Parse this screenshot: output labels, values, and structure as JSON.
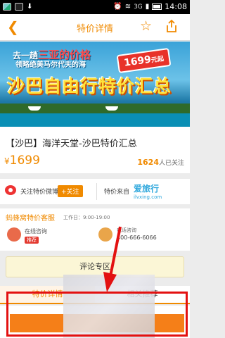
{
  "statusbar": {
    "network": "3G",
    "time": "14:08"
  },
  "header": {
    "back_glyph": "❮",
    "title": "特价详情"
  },
  "banner": {
    "line1_a": "去一趟",
    "line1_hl": "三亚的价格",
    "line2": "领略绝美马尔代夫的海",
    "price": "1699",
    "price_unit": "元起",
    "headline": "沙巴自由行特价汇总"
  },
  "product": {
    "title": "【沙巴】海洋天堂-沙巴特价汇总",
    "currency": "¥",
    "price": "1699",
    "follow_count": "1624",
    "follow_suffix": "人已关注"
  },
  "weibo": {
    "label": "关注特价微博",
    "button": "+关注"
  },
  "source": {
    "label": "特价来自",
    "logo_main": "爱旅行",
    "logo_sub": "ilvxing.com"
  },
  "service": {
    "title": "蚂蜂窝特价客服",
    "hours": "工作日：9:00-19:00",
    "online_label": "在线咨询",
    "recommend": "推荐",
    "phone_label": "电话咨询",
    "phone_number": "400-666-6066"
  },
  "comment": {
    "label": "评论专区"
  },
  "tabs": [
    {
      "label": "特价详情"
    },
    {
      "label": "相关推荐"
    }
  ],
  "colors": {
    "accent": "#f08a00",
    "annotation": "#e31111"
  }
}
